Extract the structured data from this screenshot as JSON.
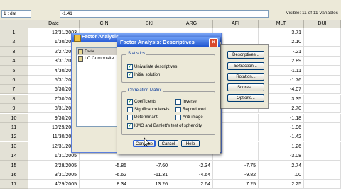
{
  "formula_bar": {
    "cell_ref": "1 : dat",
    "cell_value": "-1.41",
    "visible_text": "Visible: 11 of 11 Variables"
  },
  "columns": [
    "Date",
    "CIN",
    "BKI",
    "ARG",
    "AFI",
    "MLT",
    "DUI"
  ],
  "rows": [
    {
      "n": "1",
      "date": "12/31/2003",
      "mlt": "3.71"
    },
    {
      "n": "2",
      "date": "1/30/2004",
      "mlt": "2.10"
    },
    {
      "n": "3",
      "date": "2/27/2004",
      "mlt": "-.21"
    },
    {
      "n": "4",
      "date": "3/31/2004",
      "mlt": "2.89"
    },
    {
      "n": "5",
      "date": "4/30/2004",
      "mlt": "-1.11"
    },
    {
      "n": "6",
      "date": "5/31/2004",
      "mlt": "-1.76"
    },
    {
      "n": "7",
      "date": "6/30/2004",
      "mlt": "-4.07"
    },
    {
      "n": "8",
      "date": "7/30/2004",
      "mlt": "3.35"
    },
    {
      "n": "9",
      "date": "8/31/2004",
      "mlt": "2.70"
    },
    {
      "n": "10",
      "date": "9/30/2004",
      "mlt": "-1.18"
    },
    {
      "n": "11",
      "date": "10/29/2004",
      "mlt": "-1.96"
    },
    {
      "n": "12",
      "date": "11/30/2004",
      "mlt": "-1.42"
    },
    {
      "n": "13",
      "date": "12/31/2004",
      "mlt": "1.26"
    },
    {
      "n": "14",
      "date": "1/31/2005",
      "mlt": "-3.08"
    },
    {
      "n": "15",
      "date": "2/28/2005",
      "cin": "-5.85",
      "bki": "-7.60",
      "arg": "-2.34",
      "afi": "-7.75",
      "mlt": "2.74"
    },
    {
      "n": "16",
      "date": "3/31/2005",
      "cin": "-6.62",
      "bki": "-11.31",
      "arg": "-4.64",
      "afi": "-9.82",
      "mlt": ".00"
    },
    {
      "n": "17",
      "date": "4/29/2005",
      "cin": "8.34",
      "bki": "13.26",
      "arg": "2.64",
      "afi": "7.25",
      "mlt": "2.25"
    }
  ],
  "factor_dialog": {
    "title": "Factor Analysis",
    "variables": [
      "Date",
      "LC Composite"
    ],
    "side_buttons": [
      "Descriptives...",
      "Extraction...",
      "Rotation...",
      "Scores...",
      "Options..."
    ]
  },
  "descriptives_dialog": {
    "title": "Factor Analysis: Descriptives",
    "close_glyph": "×",
    "statistics": {
      "legend": "Statistics",
      "univariate": "Univariate descriptives",
      "initial": "Initial solution"
    },
    "correlation": {
      "legend": "Correlation Matrix",
      "coefficients": "Coefficients",
      "inverse": "Inverse",
      "significance": "Significance levels",
      "reproduced": "Reproduced",
      "determinant": "Determinant",
      "anti_image": "Anti-image",
      "kmo": "KMO and Bartlett's test of sphericity"
    },
    "buttons": {
      "continue": "Continue",
      "cancel": "Cancel",
      "help": "Help"
    }
  }
}
